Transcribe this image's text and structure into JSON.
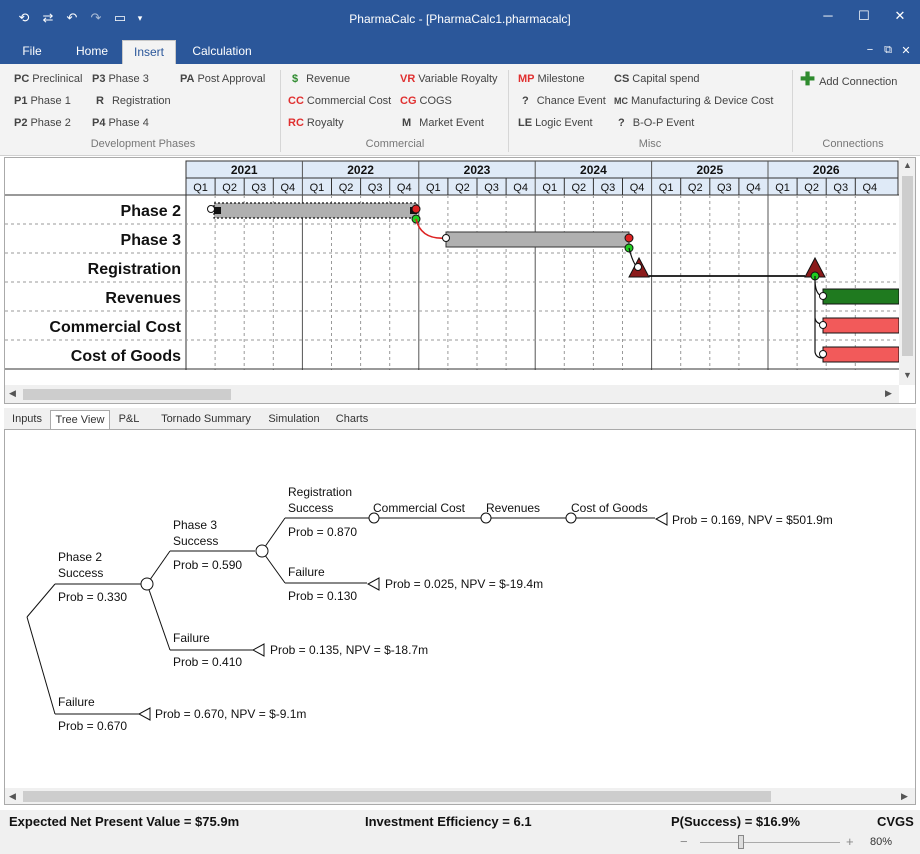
{
  "window": {
    "title": "PharmaCalc - [PharmaCalc1.pharmacalc]",
    "minimize": "─",
    "maximize": "☐",
    "close": "✕"
  },
  "quick_access": [
    "⟲",
    "⇄",
    "↶",
    "↷",
    "▭",
    "▾"
  ],
  "menu": {
    "tabs": [
      "File",
      "Home",
      "Insert",
      "Calculation"
    ],
    "active": "Insert",
    "sub_min": "−",
    "sub_restore": "⧉",
    "sub_close": "✕"
  },
  "ribbon": {
    "dev": [
      {
        "code": "PC",
        "label": "Preclinical"
      },
      {
        "code": "P1",
        "label": "Phase 1"
      },
      {
        "code": "P2",
        "label": "Phase 2"
      },
      {
        "code": "P3",
        "label": "Phase 3"
      },
      {
        "code": "R",
        "label": "Registration"
      },
      {
        "code": "P4",
        "label": "Phase 4"
      },
      {
        "code": "PA",
        "label": "Post Approval"
      }
    ],
    "dev_label": "Development Phases",
    "com": [
      {
        "code": "$",
        "label": "Revenue",
        "color": "#2e8b2e"
      },
      {
        "code": "CC",
        "label": "Commercial Cost",
        "color": "#e03030"
      },
      {
        "code": "RC",
        "label": "Royalty",
        "color": "#e03030"
      },
      {
        "code": "VR",
        "label": "Variable Royalty",
        "color": "#e03030"
      },
      {
        "code": "CG",
        "label": "COGS",
        "color": "#e03030"
      },
      {
        "code": "M",
        "label": "Market Event",
        "color": "#111111"
      }
    ],
    "com_label": "Commercial",
    "misc": [
      {
        "code": "MP",
        "label": "Milestone",
        "color": "#e03030"
      },
      {
        "code": "?",
        "label": "Chance Event",
        "color": "#111111"
      },
      {
        "code": "LE",
        "label": "Logic Event",
        "color": "#111111"
      },
      {
        "code": "CS",
        "label": "Capital spend",
        "color": "#111111"
      },
      {
        "code": "MC",
        "label": "Manufacturing & Device Cost",
        "color": "#111111"
      },
      {
        "code": "?",
        "label": "B-O-P Event",
        "color": "#111111"
      }
    ],
    "misc_label": "Misc",
    "add_connection": "Add Connection",
    "conn_label": "Connections"
  },
  "gantt": {
    "years": [
      "2021",
      "2022",
      "2023",
      "2024",
      "2025",
      "2026"
    ],
    "quarters": [
      "Q1",
      "Q2",
      "Q3",
      "Q4"
    ],
    "rows": [
      "Phase 2",
      "Phase 3",
      "Registration",
      "Revenues",
      "Commercial Cost",
      "Cost of Goods"
    ],
    "colors": {
      "phase": "#b0b0b0",
      "revenue": "#1f7a1f",
      "cost": "#f25a5a",
      "milestone": "#8b1a1a"
    }
  },
  "bottom_tabs": [
    "Inputs",
    "Tree View",
    "P&L",
    "Tornado Summary",
    "Simulation",
    "Charts"
  ],
  "tree": {
    "p2_success": [
      "Phase 2",
      "Success"
    ],
    "p2_prob": "Prob = 0.330",
    "p3_success": [
      "Phase 3",
      "Success"
    ],
    "p3_prob": "Prob = 0.590",
    "reg_success": [
      "Registration",
      "Success"
    ],
    "reg_prob": "Prob = 0.870",
    "chain": [
      "Commercial Cost",
      "Revenues",
      "Cost of Goods"
    ],
    "end_success": "Prob = 0.169, NPV = $501.9m",
    "reg_fail": "Failure",
    "reg_fail_prob": "Prob = 0.130",
    "end_reg_fail": "Prob = 0.025, NPV = $-19.4m",
    "p3_fail": "Failure",
    "p3_fail_prob": "Prob = 0.410",
    "end_p3_fail": "Prob = 0.135, NPV = $-18.7m",
    "p2_fail": "Failure",
    "p2_fail_prob": "Prob = 0.670",
    "end_p2_fail": "Prob = 0.670, NPV = $-9.1m"
  },
  "status": {
    "enpv": "Expected Net Present Value = $75.9m",
    "efficiency": "Investment Efficiency = 6.1",
    "psuccess": "P(Success) = $16.9%",
    "mode": "CVGS",
    "zoom": "80%",
    "zoom_minus": "−",
    "zoom_plus": "+"
  }
}
